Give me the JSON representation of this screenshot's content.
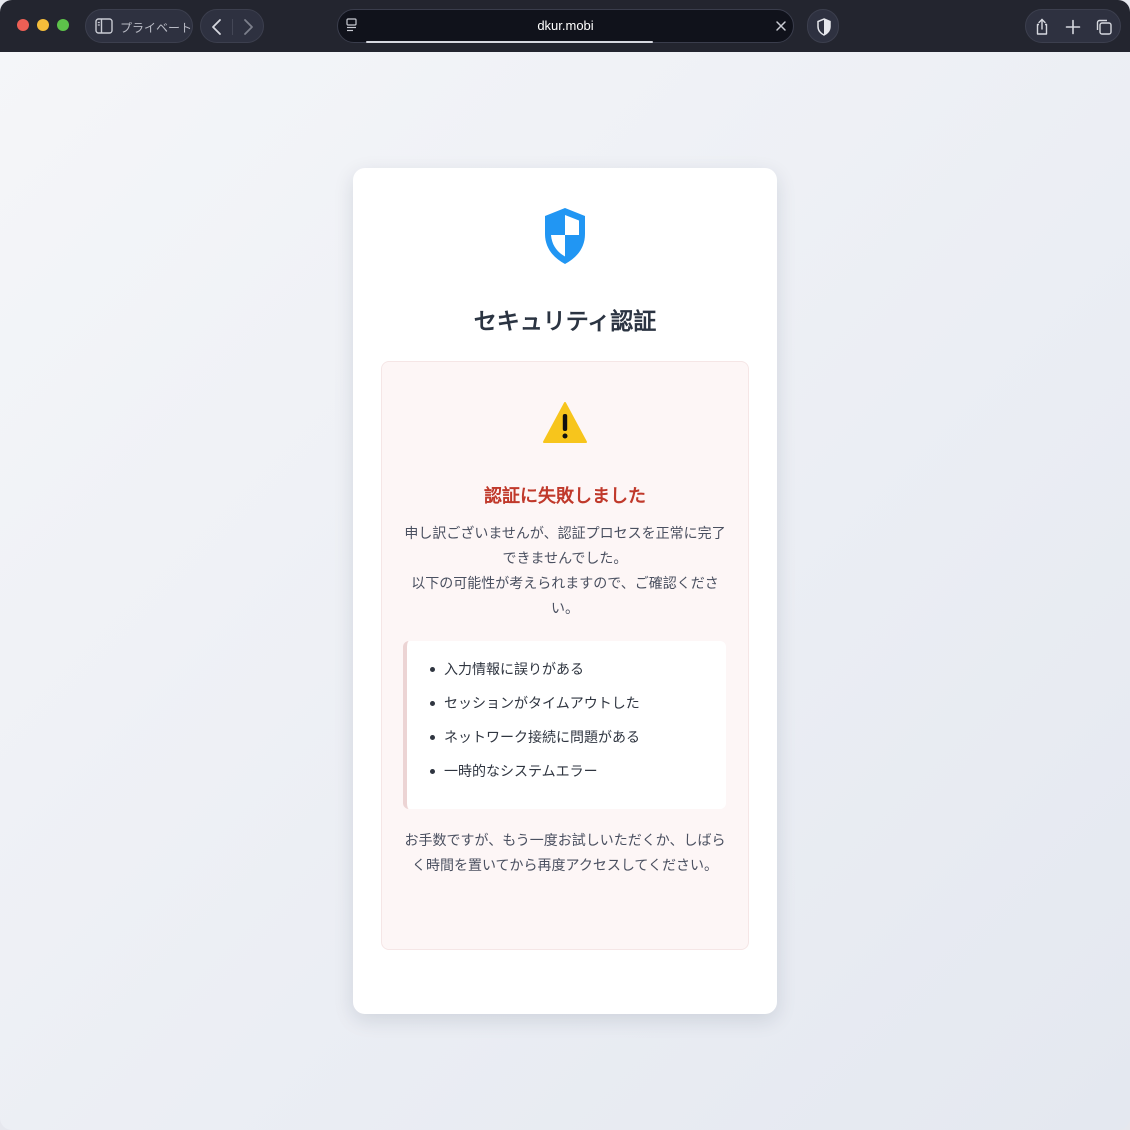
{
  "browser": {
    "private_label": "プライベート",
    "url": "dkur.mobi"
  },
  "card": {
    "title": "セキュリティ認証",
    "error": {
      "title": "認証に失敗しました",
      "description_line1": "申し訳ございませんが、認証プロセスを正常に完了できませんでした。",
      "description_line2": "以下の可能性が考えられますので、ご確認ください。",
      "reasons": [
        "入力情報に誤りがある",
        "セッションがタイムアウトした",
        "ネットワーク接続に問題がある",
        "一時的なシステムエラー"
      ],
      "retry_note": "お手数ですが、もう一度お試しいただくか、しばらく時間を置いてから再度アクセスしてください。"
    }
  },
  "colors": {
    "brand_blue": "#2196f3",
    "error_red": "#c0392b",
    "warning_yellow": "#f7c51c"
  },
  "icons": {
    "brand": "shield-icon",
    "warning": "warning-icon"
  }
}
